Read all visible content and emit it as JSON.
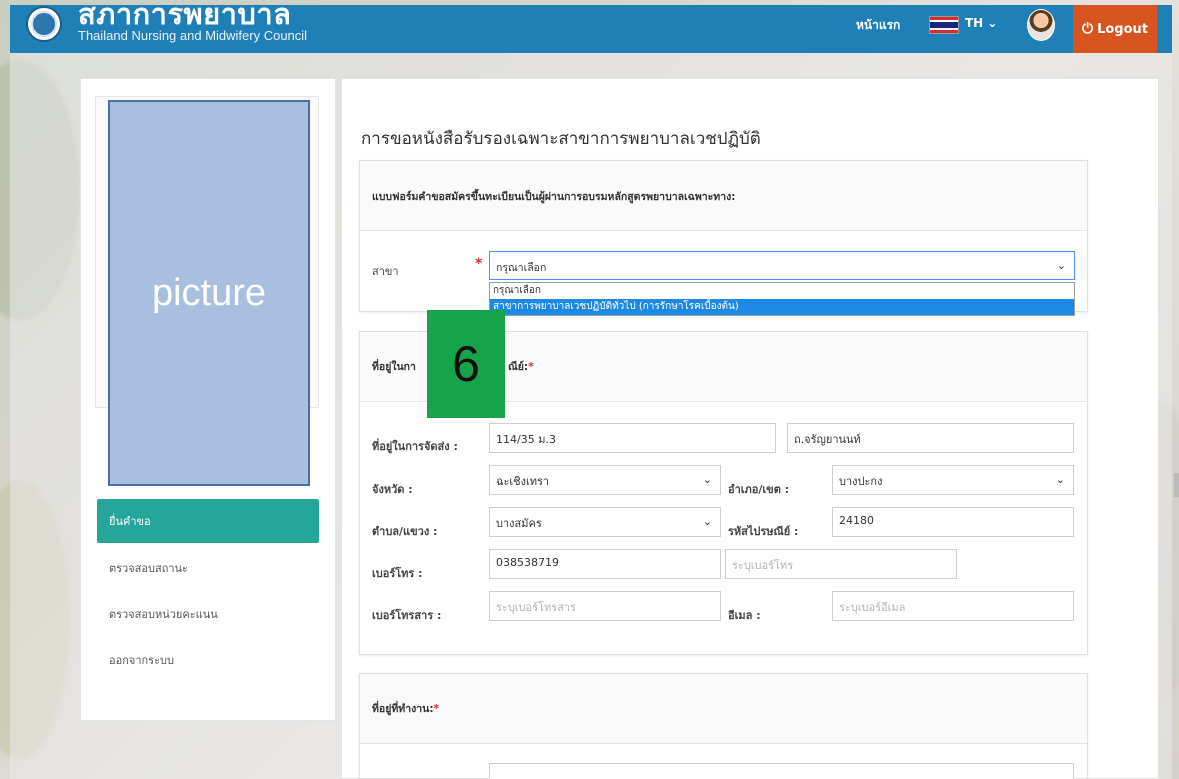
{
  "header": {
    "brand_title": "สภาการพยาบาล",
    "brand_subtitle": "Thailand Nursing and Midwifery Council",
    "home_link": "หน้าแรก",
    "language": "TH ⌄",
    "logout_label": "Logout"
  },
  "sidebar": {
    "picture_label": "picture",
    "items": [
      {
        "label": "ยื่นคำขอ",
        "active": true
      },
      {
        "label": "ตรวจสอบสถานะ",
        "active": false
      },
      {
        "label": "ตรวจสอบหน่วยคะแนน",
        "active": false
      },
      {
        "label": "ออกจากระบบ",
        "active": false
      }
    ]
  },
  "main": {
    "title": "การขอหนังสือรับรองเฉพาะสาขาการพยาบาลเวชปฏิบัติ",
    "form_heading": "แบบฟอร์มคำขอสมัครขึ้นทะเบียนเป็นผู้ผ่านการอบรมหลักสูตรพยาบาลเฉพาะทาง:",
    "branch": {
      "label": "สาขา",
      "selected": "กรุณาเลือก",
      "options": [
        {
          "label": "กรุณาเลือก",
          "highlighted": false
        },
        {
          "label": "สาขาการพยาบาลเวชปฏิบัติทั่วไป (การรักษาโรคเบื้องต้น)",
          "highlighted": true
        }
      ]
    },
    "step_badge": "6",
    "mailing_section": {
      "heading_visible": "ที่อยู่ในกา",
      "heading_tail": "ณีย์:",
      "address_label": "ที่อยู่ในการจัดส่ง :",
      "address_line1": "114/35 ม.3",
      "address_line2": "ถ.จรัญยานนท์",
      "province_label": "จังหวัด :",
      "province_value": "ฉะเชิงเทรา",
      "district_label": "อำเภอ/เขต :",
      "district_value": "บางปะกง",
      "subdistrict_label": "ตำบล/แขวง :",
      "subdistrict_value": "บางสมัคร",
      "postcode_label": "รหัสไปรษณีย์ :",
      "postcode_value": "24180",
      "phone_label": "เบอร์โทร :",
      "phone_value": "038538719",
      "phone2_placeholder": "ระบุเบอร์โทร",
      "fax_label": "เบอร์โทรสาร :",
      "fax_placeholder": "ระบุเบอร์โทรสาร",
      "email_label": "อีเมล :",
      "email_placeholder": "ระบุเบอร์อีเมล"
    },
    "work_section": {
      "heading": "ที่อยู่ที่ทำงาน:"
    }
  },
  "colors": {
    "header_blue": "#1f7fb7",
    "logout_orange": "#d8541f",
    "active_teal": "#26a69a",
    "badge_green": "#16a34a",
    "picture_fill": "#a8bfe0",
    "required_red": "#d32f2f"
  }
}
